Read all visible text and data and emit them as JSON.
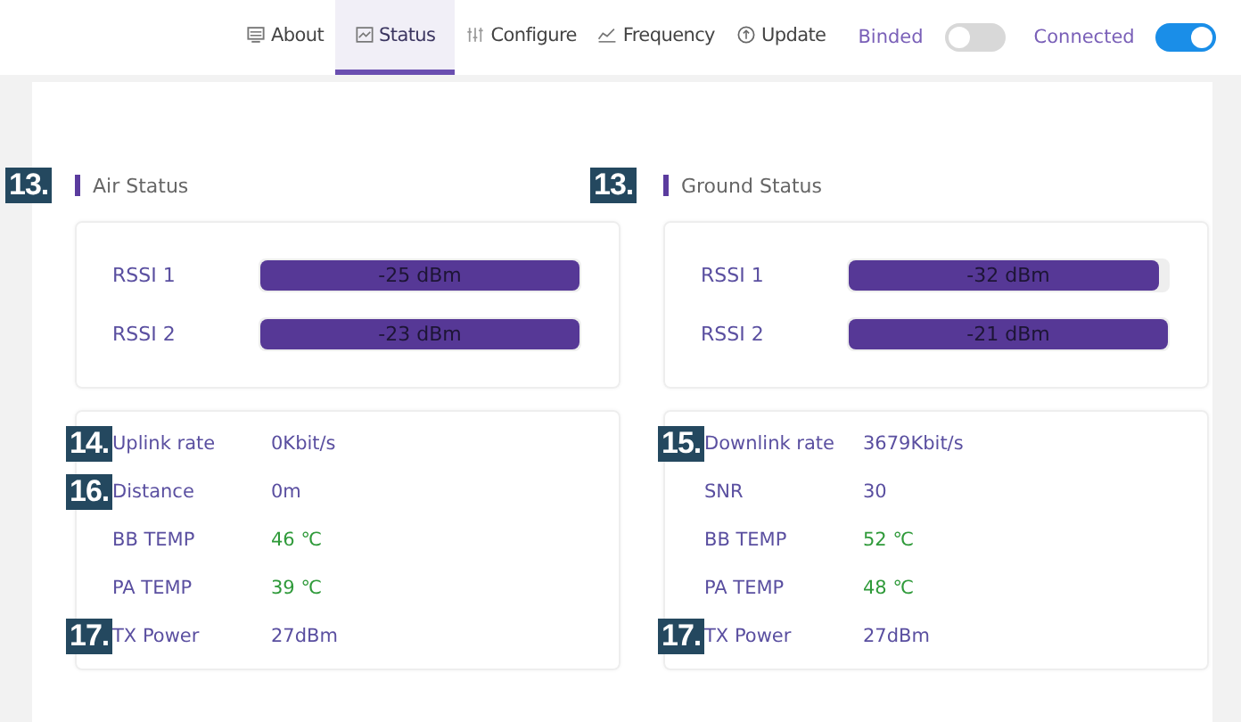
{
  "tabs": [
    {
      "label": "About",
      "selected": false
    },
    {
      "label": "Status",
      "selected": true
    },
    {
      "label": "Configure",
      "selected": false
    },
    {
      "label": "Frequency",
      "selected": false
    },
    {
      "label": "Update",
      "selected": false
    }
  ],
  "toggles": [
    {
      "label": "Binded",
      "on": false
    },
    {
      "label": "Connected",
      "on": true
    }
  ],
  "panels": [
    {
      "callout": "13.",
      "title": "Air Status",
      "rssi": [
        {
          "label": "RSSI 1",
          "reading": "-25 dBm",
          "level": 1
        },
        {
          "label": "RSSI 2",
          "reading": "-23 dBm",
          "level": 1
        }
      ],
      "rows": [
        {
          "callout": "14.",
          "label": "Uplink rate",
          "value": "0Kbit/s",
          "kind": "text"
        },
        {
          "callout": "16.",
          "label": "Distance",
          "value": "0m",
          "kind": "text"
        },
        {
          "label": "BB TEMP",
          "value": "46 ℃",
          "kind": "temp"
        },
        {
          "label": "PA TEMP",
          "value": "39 ℃",
          "kind": "temp"
        },
        {
          "callout": "17.",
          "label": "TX Power",
          "value": "27dBm",
          "kind": "text"
        }
      ]
    },
    {
      "callout": "13.",
      "title": "Ground Status",
      "rssi": [
        {
          "label": "RSSI 1",
          "reading": "-32 dBm",
          "level": 0.97
        },
        {
          "label": "RSSI 2",
          "reading": "-21 dBm",
          "level": 1
        }
      ],
      "rows": [
        {
          "callout": "15.",
          "label": "Downlink rate",
          "value": "3679Kbit/s",
          "kind": "text"
        },
        {
          "label": "SNR",
          "value": "30",
          "kind": "text"
        },
        {
          "label": "BB TEMP",
          "value": "52 ℃",
          "kind": "temp"
        },
        {
          "label": "PA TEMP",
          "value": "48 ℃",
          "kind": "temp"
        },
        {
          "callout": "17.",
          "label": "TX Power",
          "value": "27dBm",
          "kind": "text"
        }
      ]
    }
  ]
}
